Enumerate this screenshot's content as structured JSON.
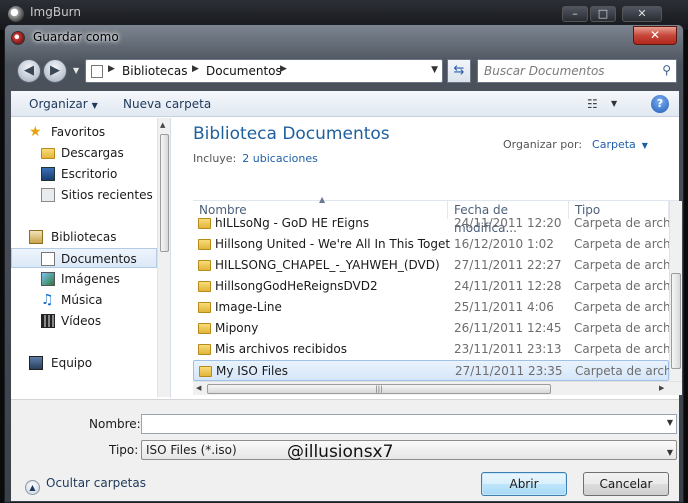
{
  "background_app": {
    "title": "ImgBurn"
  },
  "dialog": {
    "title": "Guardar como",
    "close_label": "✕"
  },
  "address": {
    "crumbs": [
      "Bibliotecas",
      "Documentos"
    ],
    "search_placeholder": "Buscar Documentos"
  },
  "toolbar": {
    "organize": "Organizar",
    "new_folder": "Nueva carpeta",
    "help": "?"
  },
  "sidebar": {
    "favorites": "Favoritos",
    "fav_items": [
      "Descargas",
      "Escritorio",
      "Sitios recientes"
    ],
    "libraries": "Bibliotecas",
    "lib_items": [
      "Documentos",
      "Imágenes",
      "Música",
      "Vídeos"
    ],
    "computer": "Equipo"
  },
  "library": {
    "title": "Biblioteca Documentos",
    "includes_label": "Incluye:",
    "includes_link": "2 ubicaciones",
    "arrange_label": "Organizar por:",
    "arrange_value": "Carpeta"
  },
  "columns": {
    "name": "Nombre",
    "date": "Fecha de modifica...",
    "type": "Tipo"
  },
  "files": [
    {
      "name": "hILLsoNg - GoD HE rEigns",
      "date": "24/11/2011 12:20",
      "type": "Carpeta de archivos"
    },
    {
      "name": "Hillsong United - We're All In This Toget...",
      "date": "16/12/2010 1:02",
      "type": "Carpeta de archivos"
    },
    {
      "name": "HILLSONG_CHAPEL_-_YAHWEH_(DVD)",
      "date": "27/11/2011 22:27",
      "type": "Carpeta de archivos"
    },
    {
      "name": "HillsongGodHeReignsDVD2",
      "date": "24/11/2011 12:28",
      "type": "Carpeta de archivos"
    },
    {
      "name": "Image-Line",
      "date": "25/11/2011 4:06",
      "type": "Carpeta de archivos"
    },
    {
      "name": "Mipony",
      "date": "26/11/2011 12:45",
      "type": "Carpeta de archivos"
    },
    {
      "name": "Mis archivos recibidos",
      "date": "23/11/2011 23:13",
      "type": "Carpeta de archivos"
    },
    {
      "name": "My ISO Files",
      "date": "27/11/2011 23:35",
      "type": "Carpeta de archivos"
    }
  ],
  "form": {
    "name_label": "Nombre:",
    "name_value": "",
    "type_label": "Tipo:",
    "type_value": "ISO Files (*.iso)",
    "watermark": "@illusionsx7",
    "hide_folders": "Ocultar carpetas",
    "open_button": "Abrir",
    "cancel_button": "Cancelar"
  }
}
